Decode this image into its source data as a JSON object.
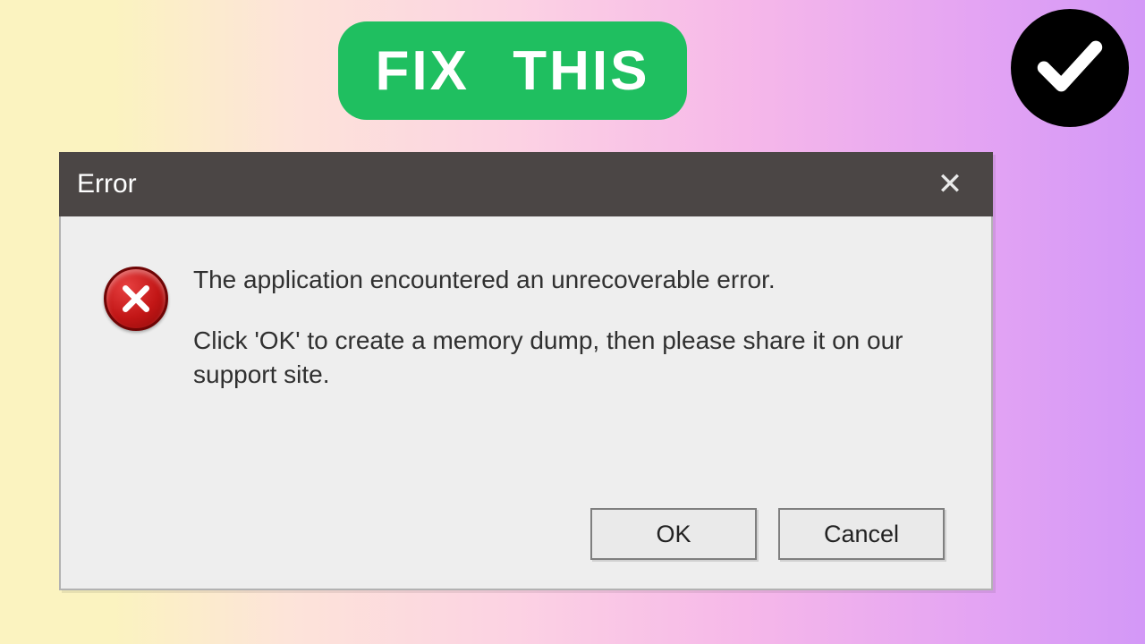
{
  "banner": {
    "fix_label": "FIX  THIS"
  },
  "dialog": {
    "title": "Error",
    "message_line1": "The application encountered an unrecoverable error.",
    "message_line2": "Click 'OK' to create a memory dump, then please share it on our support site.",
    "buttons": {
      "ok": "OK",
      "cancel": "Cancel"
    }
  }
}
